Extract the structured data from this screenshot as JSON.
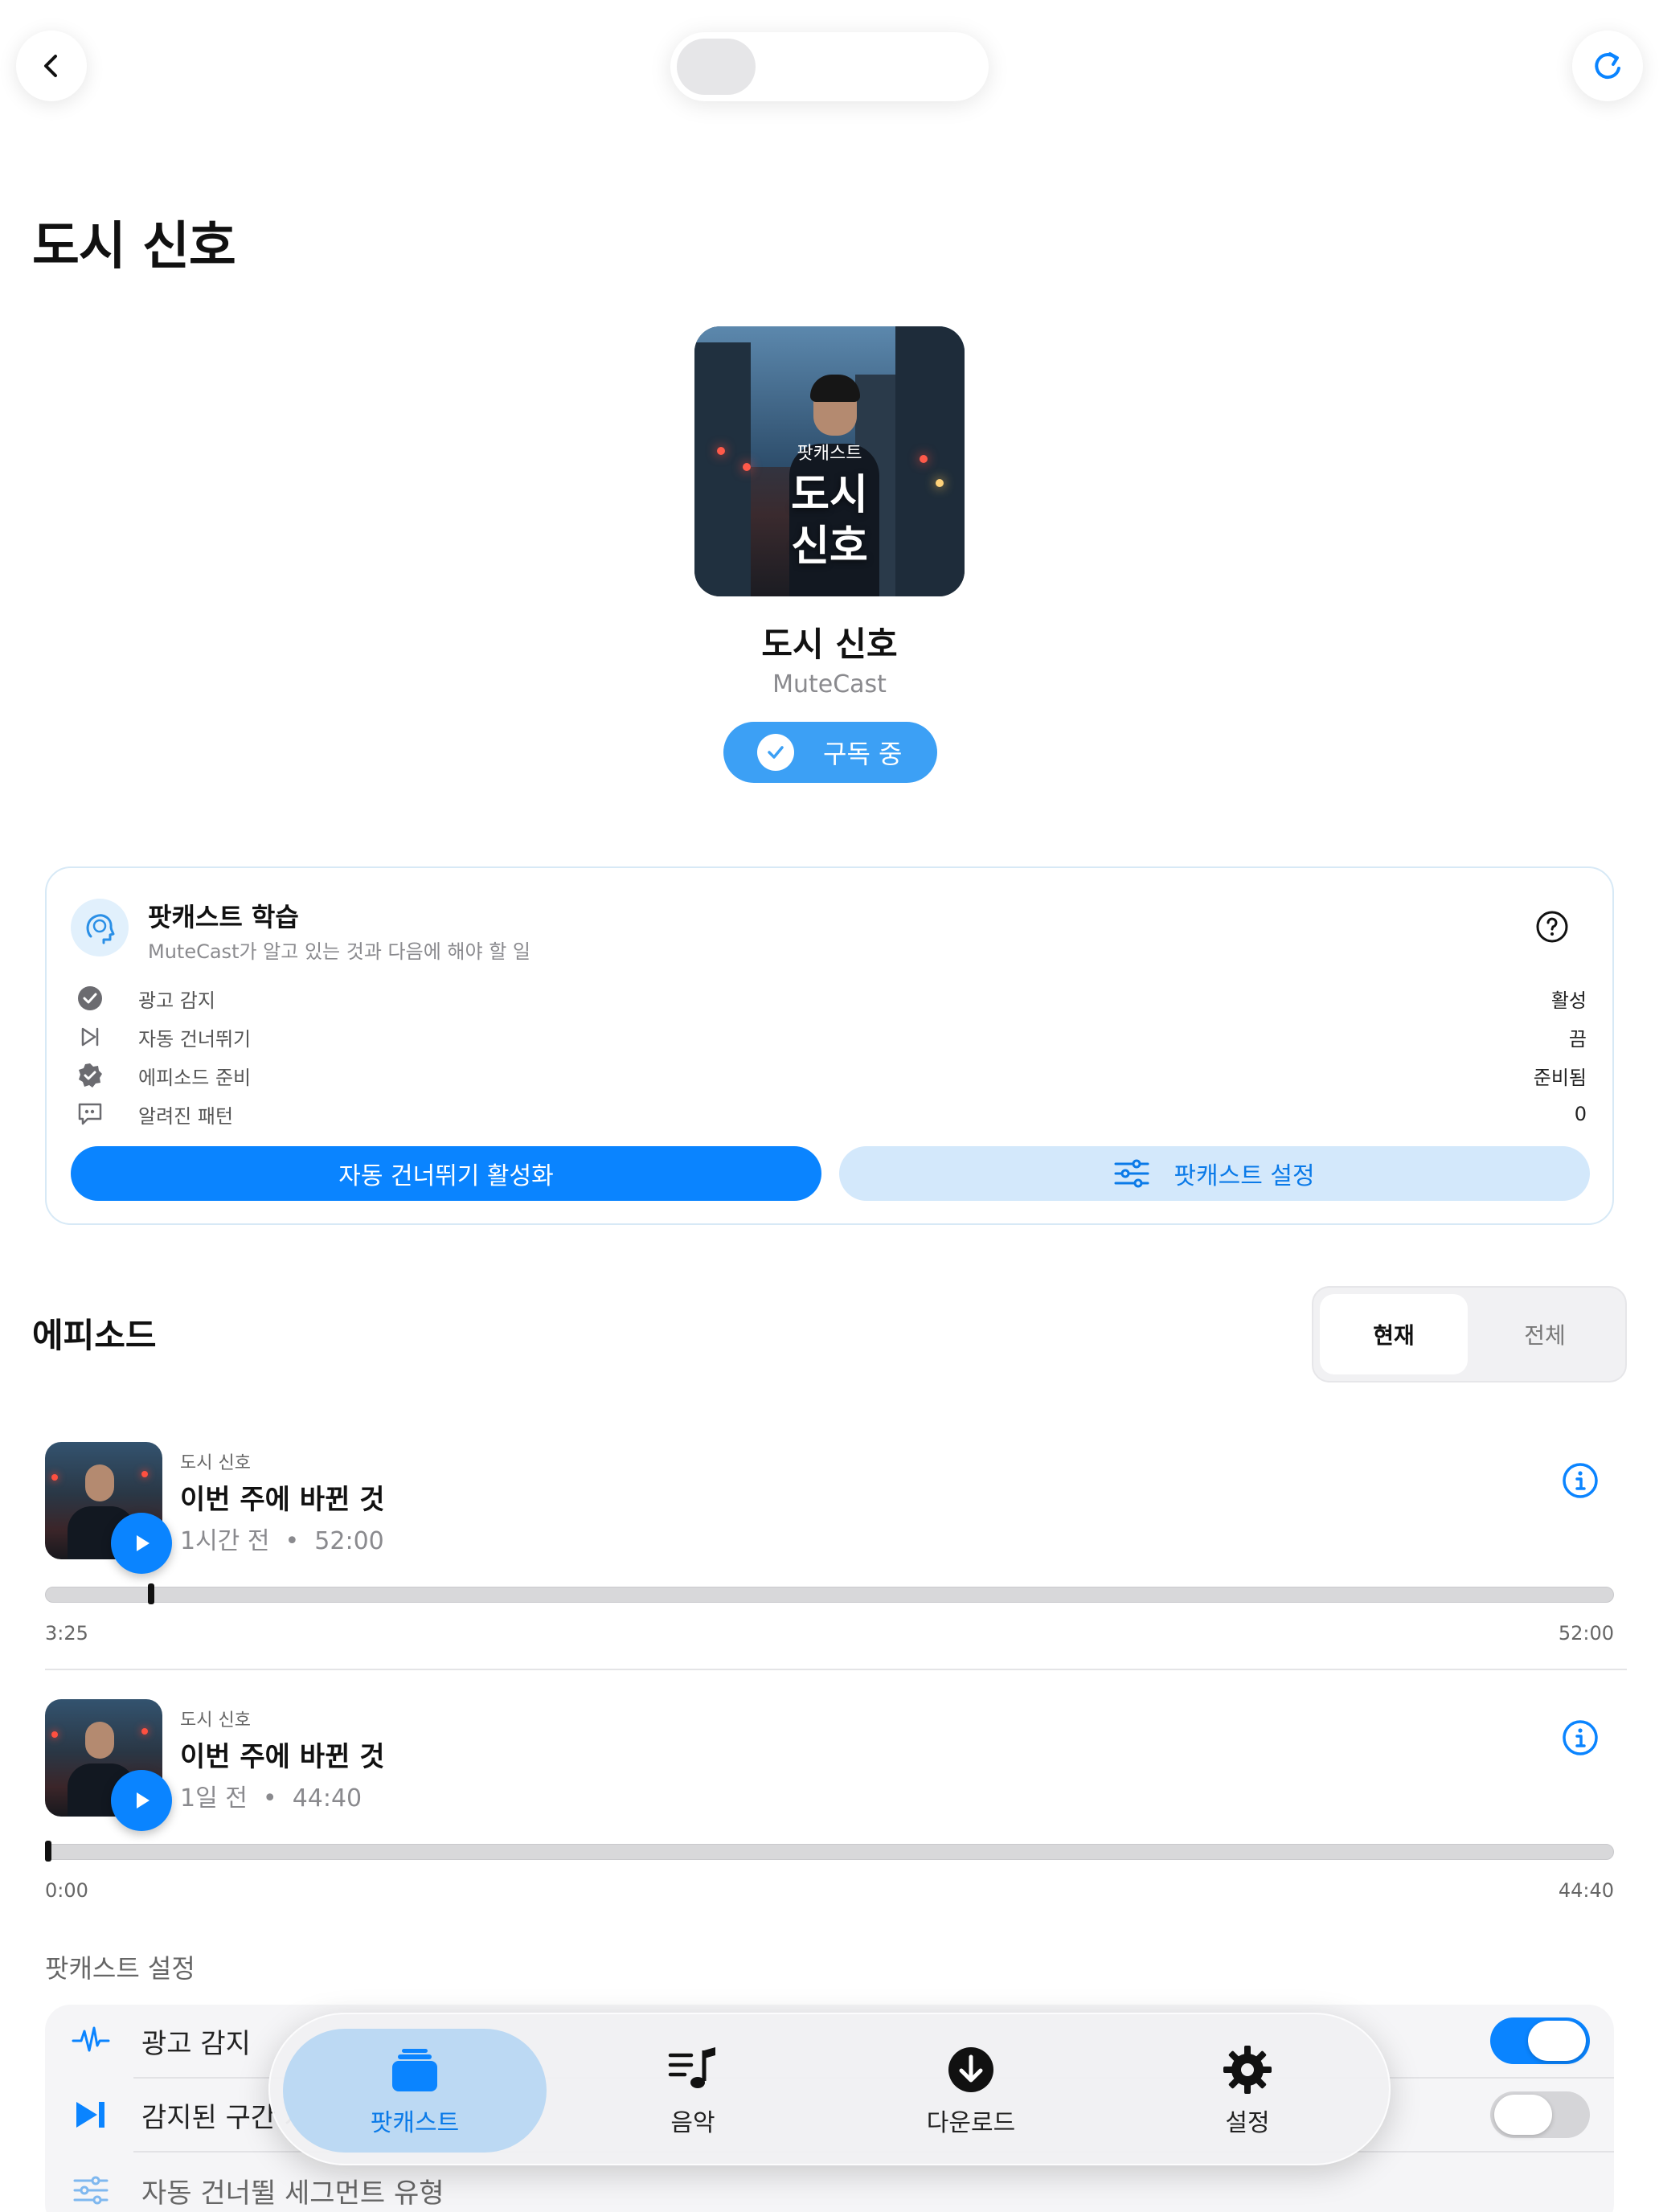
{
  "page": {
    "title": "도시 신호"
  },
  "podcast": {
    "name": "도시 신호",
    "author": "MuteCast",
    "cover_small": "팟캐스트",
    "cover_title_line1": "도시",
    "cover_title_line2": "신호",
    "subscribe_label": "구독 중"
  },
  "learning": {
    "title": "팟캐스트 학습",
    "description": "MuteCast가 알고 있는 것과 다음에 해야 할 일",
    "rows": [
      {
        "icon": "check-circle-icon",
        "label": "광고 감지",
        "value": "활성"
      },
      {
        "icon": "skip-forward-icon",
        "label": "자동 건너뛰기",
        "value": "끔"
      },
      {
        "icon": "verified-badge-icon",
        "label": "에피소드 준비",
        "value": "준비됨"
      },
      {
        "icon": "quote-bubble-icon",
        "label": "알려진 패턴",
        "value": "0"
      }
    ],
    "primary_button": "자동 건너뛰기 활성화",
    "secondary_button": "팟캐스트 설정"
  },
  "episodes": {
    "section_title": "에피소드",
    "segments": [
      "현재",
      "전체"
    ],
    "selected_segment": "현재",
    "items": [
      {
        "source": "도시 신호",
        "title": "이번 주에 바뀐 것",
        "age": "1시간 전",
        "sep": "•",
        "duration": "52:00",
        "current": "3:25",
        "total": "52:00",
        "progress": 0.0657
      },
      {
        "source": "도시 신호",
        "title": "이번 주에 바뀐 것",
        "age": "1일 전",
        "sep": "•",
        "duration": "44:40",
        "current": "0:00",
        "total": "44:40",
        "progress": 0.0
      }
    ]
  },
  "settings": {
    "header": "팟캐스트 설정",
    "rows": [
      {
        "icon": "waveform-icon",
        "label": "광고 감지",
        "toggle": true
      },
      {
        "icon": "skip-end-icon",
        "label": "감지된 구간 자동 건너뛰기",
        "toggle": false
      },
      {
        "icon": "sliders-icon",
        "label": "자동 건너뛸 세그먼트 유형"
      }
    ]
  },
  "tabbar": {
    "tabs": [
      {
        "icon": "stack-icon",
        "label": "팟캐스트",
        "active": true
      },
      {
        "icon": "music-list-icon",
        "label": "음악",
        "active": false
      },
      {
        "icon": "download-icon",
        "label": "다운로드",
        "active": false
      },
      {
        "icon": "gear-icon",
        "label": "설정",
        "active": false
      }
    ]
  },
  "colors": {
    "accent": "#0a84ff",
    "accent_light": "#d3e8fb",
    "toggle_on": "#0a84ff",
    "toggle_off": "#d5d5d8"
  }
}
